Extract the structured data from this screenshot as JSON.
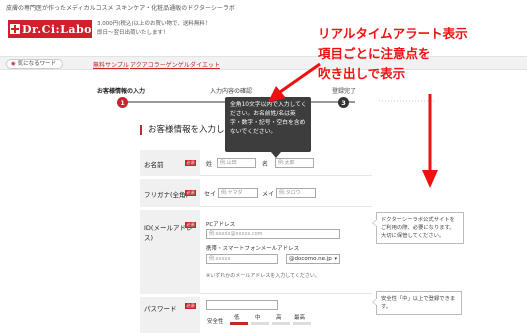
{
  "header": {
    "tagline": "皮膚の専門医が作ったメディカルコスメ スキンケア・化粧品通販のドクターシーラボ",
    "logo_text": "Dr.Ci:Labo",
    "shipping_line1": "3,000円(税込)以上のお買い物で、送料無料！",
    "shipping_line2": "即日～翌日出荷いたします！"
  },
  "keywords": {
    "label": "気になるワード",
    "links": [
      "無料サンプル",
      "アクアコラーゲンゲル",
      "ダイエット"
    ]
  },
  "steps": [
    {
      "label": "お客様情報の入力",
      "num": "1"
    },
    {
      "label": "入力内容の確認",
      "num": "2"
    },
    {
      "label": "登録完了",
      "num": "3"
    }
  ],
  "tooltip": {
    "text": "全角10文字以内で入力してください。お名前姓/名は英字・数字・記号・空白を含めないでください。"
  },
  "form": {
    "section_title": "お客様情報を入力してくださ",
    "required": "必須",
    "name": {
      "label": "お名前",
      "sei": "姓",
      "mei": "名",
      "sei_placeholder": "例:山田",
      "mei_placeholder": "例:太郎"
    },
    "furigana": {
      "label": "フリガナ(全角)",
      "sei": "セイ",
      "mei": "メイ",
      "sei_placeholder": "例:ヤマダ",
      "mei_placeholder": "例:タロウ"
    },
    "email": {
      "label": "ID(メールアドレス)",
      "pc_label": "PCアドレス",
      "pc_placeholder": "例:xxxxx@xxxxx.com",
      "mobile_label": "携帯・スマートフォンメールアドレス",
      "mobile_placeholder": "例:xxxxx",
      "domain_selected": "@docomo.ne.jp",
      "note": "※いずれかのメールアドレスを入力してください。"
    },
    "password": {
      "label": "パスワード",
      "strength_label": "安全性",
      "levels": [
        "低",
        "中",
        "高",
        "最高"
      ]
    }
  },
  "annotations": {
    "headline_line1": "リアルタイムアラート表示",
    "headline_line2": "項目ごとに注意点を",
    "headline_line3": "吹き出しで表示",
    "note_email": "ドクターシーラボ公式サイトをご利用の際、必要になります。大切に保管してください。",
    "note_password": "安全性「中」以上で登録できます。"
  },
  "colors": {
    "brand_red": "#d11f2b",
    "alert_red": "#ee1111",
    "tooltip_bg": "#3d3d3d"
  }
}
